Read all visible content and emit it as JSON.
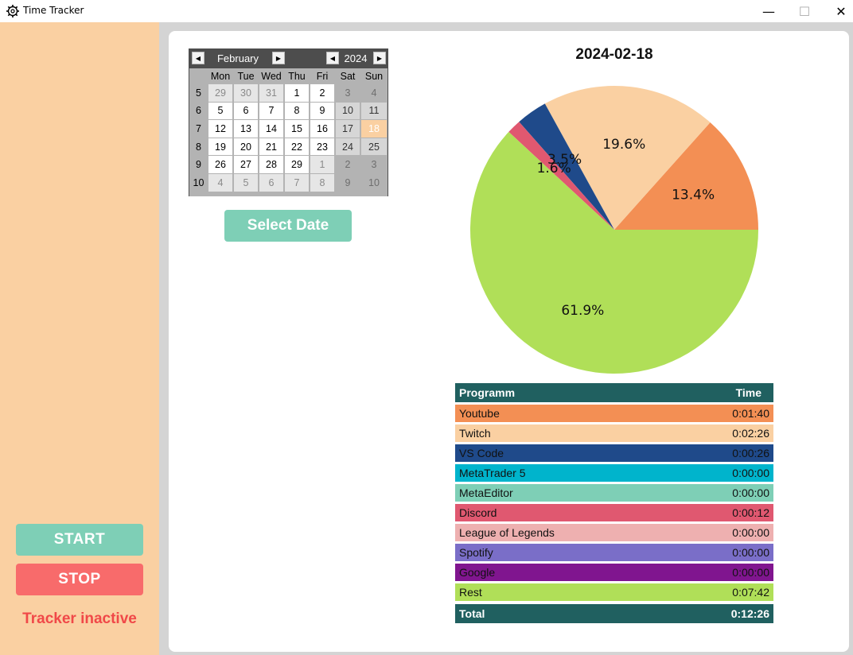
{
  "window": {
    "title": "Time Tracker",
    "minimize_glyph": "—",
    "maximize_glyph": "☐",
    "close_glyph": "✕"
  },
  "sidebar": {
    "start_label": "START",
    "stop_label": "STOP",
    "status_text": "Tracker inactive",
    "start_color": "#7ecfb6",
    "stop_color": "#f86b6b",
    "status_color": "#f04848",
    "background": "#fad0a2"
  },
  "calendar": {
    "month": "February",
    "year": "2024",
    "prev_month_icon": "◀",
    "next_month_icon": "▶",
    "prev_year_icon": "◀",
    "next_year_icon": "▶",
    "day_names": [
      "Mon",
      "Tue",
      "Wed",
      "Thu",
      "Fri",
      "Sat",
      "Sun"
    ],
    "weeks": [
      {
        "num": "5",
        "days": [
          [
            "29",
            "other"
          ],
          [
            "30",
            "other"
          ],
          [
            "31",
            "other"
          ],
          [
            "1",
            "cur"
          ],
          [
            "2",
            "cur"
          ],
          [
            "3",
            "we-other"
          ],
          [
            "4",
            "we-other"
          ]
        ]
      },
      {
        "num": "6",
        "days": [
          [
            "5",
            "cur"
          ],
          [
            "6",
            "cur"
          ],
          [
            "7",
            "cur"
          ],
          [
            "8",
            "cur"
          ],
          [
            "9",
            "cur"
          ],
          [
            "10",
            "we"
          ],
          [
            "11",
            "we"
          ]
        ]
      },
      {
        "num": "7",
        "days": [
          [
            "12",
            "cur"
          ],
          [
            "13",
            "cur"
          ],
          [
            "14",
            "cur"
          ],
          [
            "15",
            "cur"
          ],
          [
            "16",
            "cur"
          ],
          [
            "17",
            "we"
          ],
          [
            "18",
            "sel"
          ]
        ]
      },
      {
        "num": "8",
        "days": [
          [
            "19",
            "cur"
          ],
          [
            "20",
            "cur"
          ],
          [
            "21",
            "cur"
          ],
          [
            "22",
            "cur"
          ],
          [
            "23",
            "cur"
          ],
          [
            "24",
            "we"
          ],
          [
            "25",
            "we"
          ]
        ]
      },
      {
        "num": "9",
        "days": [
          [
            "26",
            "cur"
          ],
          [
            "27",
            "cur"
          ],
          [
            "28",
            "cur"
          ],
          [
            "29",
            "cur"
          ],
          [
            "1",
            "other"
          ],
          [
            "2",
            "we-other"
          ],
          [
            "3",
            "we-other"
          ]
        ]
      },
      {
        "num": "10",
        "days": [
          [
            "4",
            "other"
          ],
          [
            "5",
            "other"
          ],
          [
            "6",
            "other"
          ],
          [
            "7",
            "other"
          ],
          [
            "8",
            "other"
          ],
          [
            "9",
            "we-other"
          ],
          [
            "10",
            "we-other"
          ]
        ]
      }
    ],
    "selected_color": "#fad0a2"
  },
  "select_date_label": "Select Date",
  "chart_data": {
    "type": "pie",
    "title": "2024-02-18",
    "slices": [
      {
        "label": "Youtube",
        "percent": 13.4,
        "color": "#f38f54",
        "pct_label": "13.4%"
      },
      {
        "label": "Twitch",
        "percent": 19.6,
        "color": "#fad0a2",
        "pct_label": "19.6%"
      },
      {
        "label": "VS Code",
        "percent": 3.5,
        "color": "#1f4a8a",
        "pct_label": "3.5%"
      },
      {
        "label": "Discord",
        "percent": 1.6,
        "color": "#e05870",
        "pct_label": "1.6%"
      },
      {
        "label": "Rest",
        "percent": 61.9,
        "color": "#b0df58",
        "pct_label": "61.9%"
      }
    ]
  },
  "table": {
    "header_program": "Programm",
    "header_time": "Time",
    "rows": [
      {
        "name": "Youtube",
        "time": "0:01:40",
        "color": "#f38f54"
      },
      {
        "name": "Twitch",
        "time": "0:02:26",
        "color": "#fad0a2"
      },
      {
        "name": "VS Code",
        "time": "0:00:26",
        "color": "#1f4a8a"
      },
      {
        "name": "MetaTrader 5",
        "time": "0:00:00",
        "color": "#00b4cc"
      },
      {
        "name": "MetaEditor",
        "time": "0:00:00",
        "color": "#7ecfb6"
      },
      {
        "name": "Discord",
        "time": "0:00:12",
        "color": "#e05870"
      },
      {
        "name": "League of Legends",
        "time": "0:00:00",
        "color": "#eeb0b0"
      },
      {
        "name": "Spotify",
        "time": "0:00:00",
        "color": "#7a6ec8"
      },
      {
        "name": "Google",
        "time": "0:00:00",
        "color": "#80158f"
      },
      {
        "name": "Rest",
        "time": "0:07:42",
        "color": "#b0df58"
      }
    ],
    "total_label": "Total",
    "total_time": "0:12:26",
    "header_color": "#206060"
  }
}
